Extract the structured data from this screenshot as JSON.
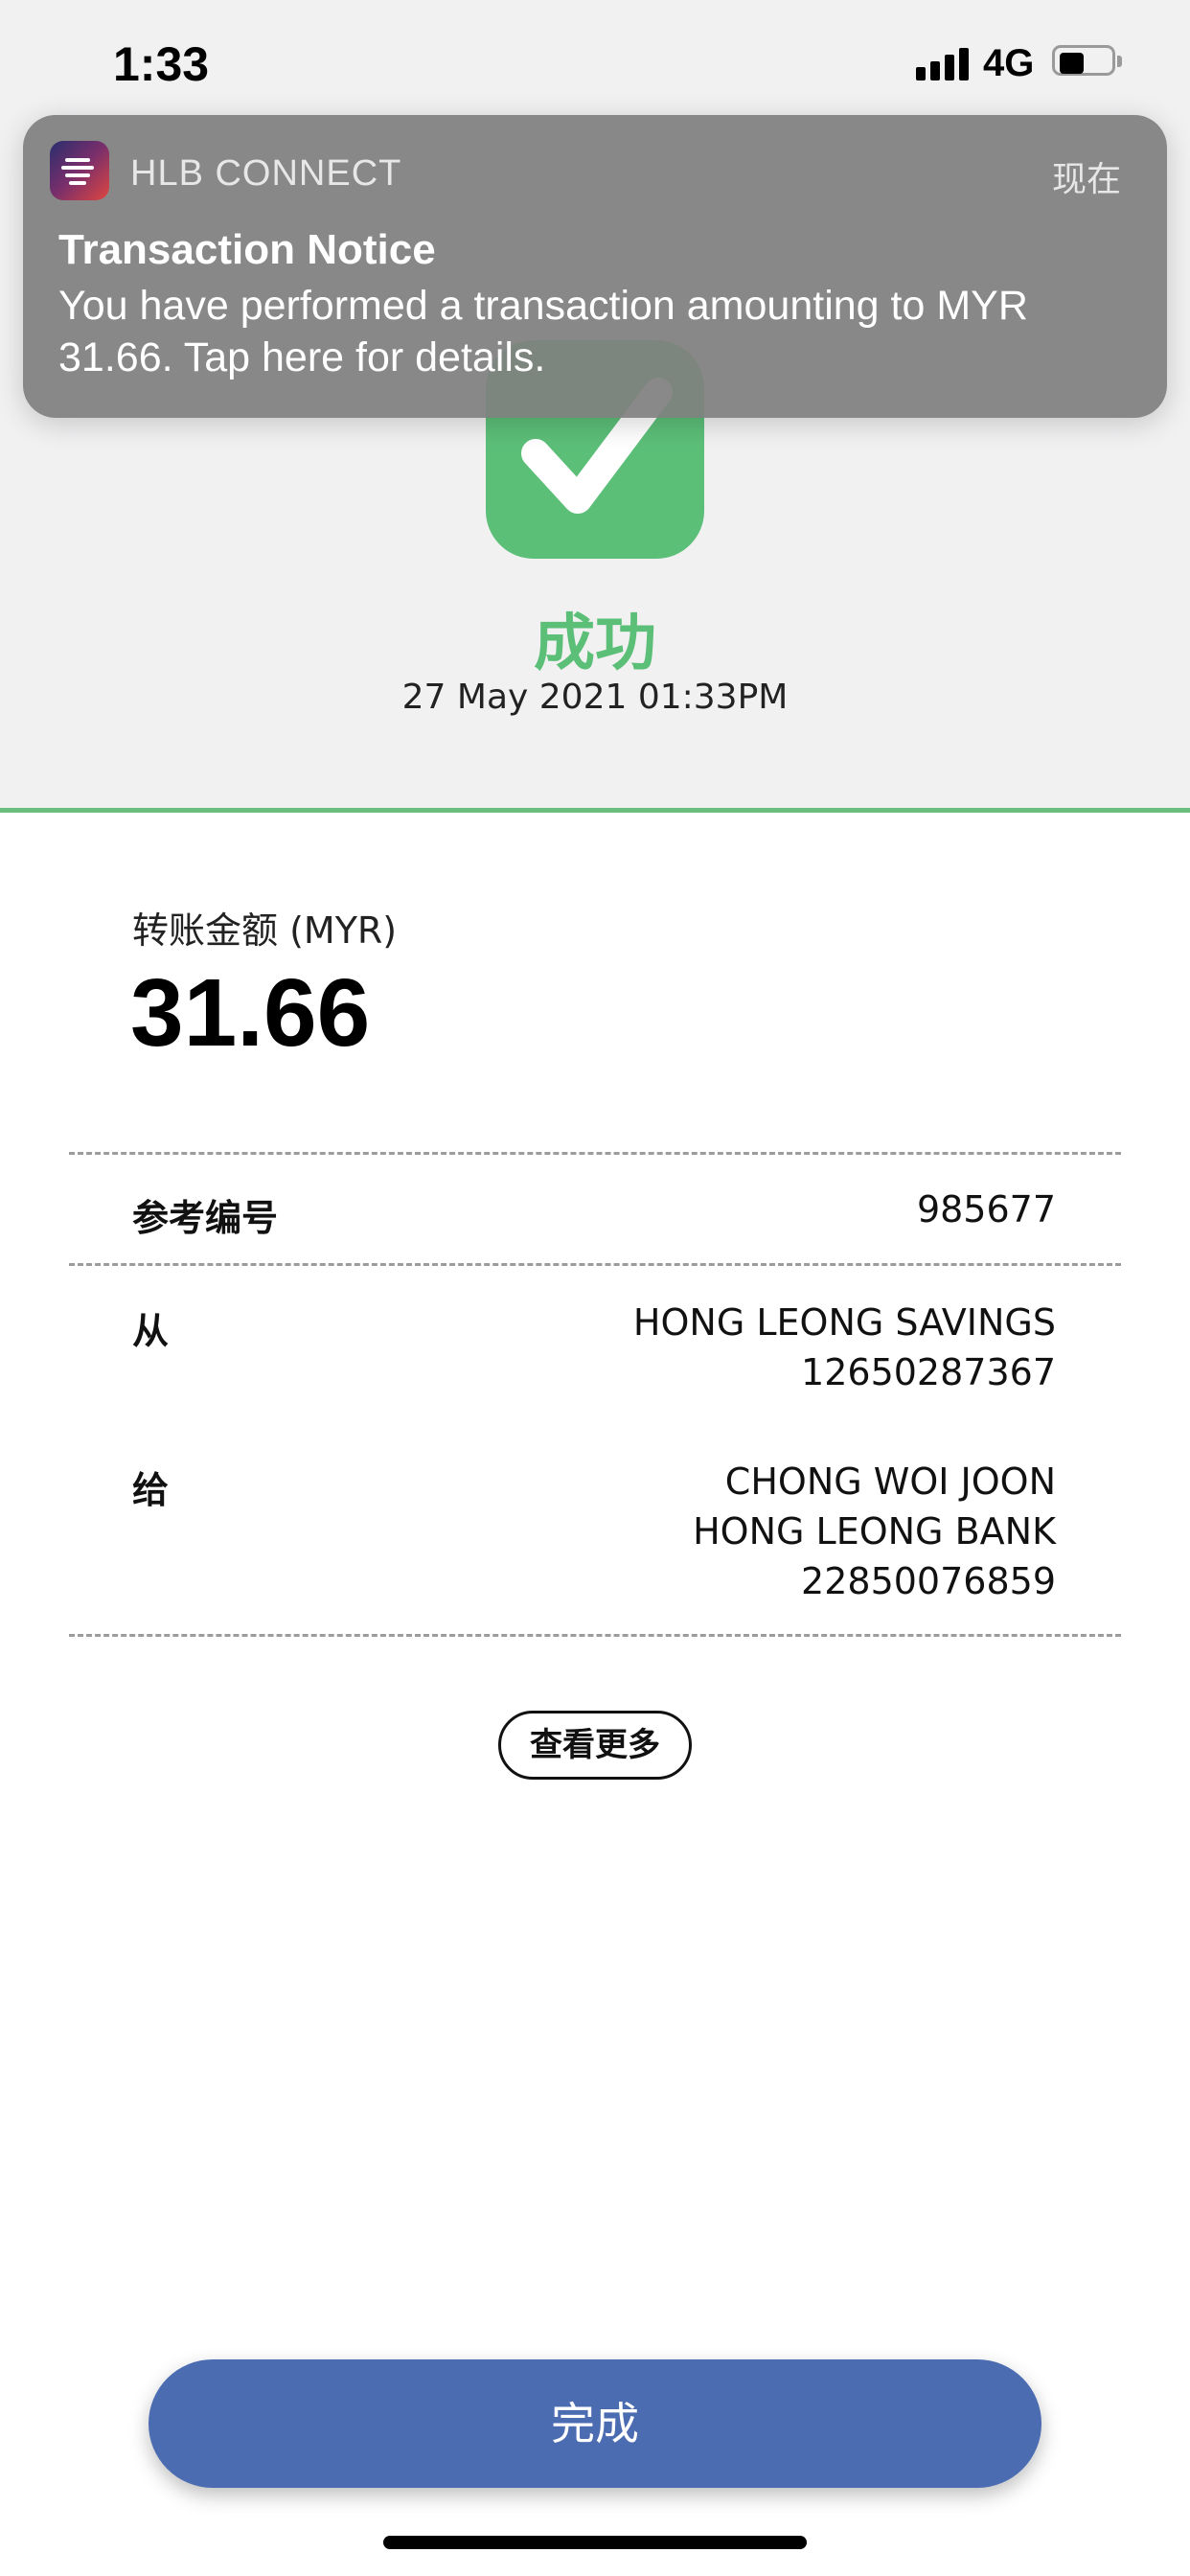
{
  "status_bar": {
    "time": "1:33",
    "network": "4G",
    "battery_level": 0.45,
    "icons": [
      "signal-icon",
      "battery-icon"
    ]
  },
  "notification": {
    "app_name": "HLB CONNECT",
    "time": "现在",
    "title": "Transaction Notice",
    "body": "You have performed a transaction amounting to MYR 31.66. Tap here for details.",
    "icon": "hlb-app-icon"
  },
  "status": {
    "icon": "check-icon",
    "title": "成功",
    "datetime": "27 May 2021 01:33PM"
  },
  "amount": {
    "label": "转账金额 (MYR)",
    "value": "31.66"
  },
  "details": {
    "reference": {
      "label": "参考编号",
      "value": "985677"
    },
    "from": {
      "label": "从",
      "lines": [
        "HONG LEONG SAVINGS",
        "12650287367"
      ]
    },
    "to": {
      "label": "给",
      "lines": [
        "CHONG WOI JOON",
        "HONG LEONG BANK",
        "22850076859"
      ]
    }
  },
  "view_more_label": "查看更多",
  "done_label": "完成",
  "colors": {
    "success_green": "#5cbf78",
    "primary_button": "#4c6cb2",
    "notification_bg": "#808080"
  }
}
